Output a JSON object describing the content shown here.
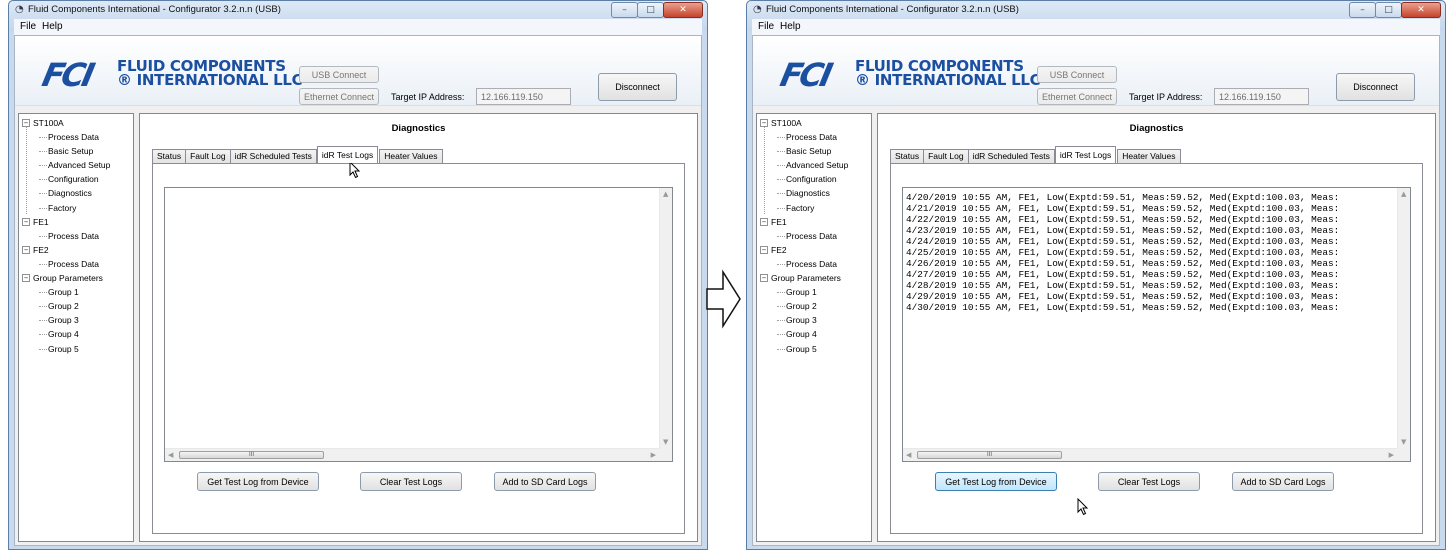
{
  "window": {
    "title": "Fluid Components International - Configurator 3.2.n.n (USB)",
    "app_icon": "gauge-icon",
    "minimize_glyph": "–",
    "maximize_glyph": "□",
    "close_glyph": "✕"
  },
  "menu": {
    "file": "File",
    "help": "Help"
  },
  "logo": {
    "mark": "FCI",
    "line1": "FLUID COMPONENTS",
    "line2": "® INTERNATIONAL LLC"
  },
  "connection": {
    "usb_connect": "USB Connect",
    "ethernet_connect": "Ethernet Connect",
    "target_ip_label": "Target IP Address:",
    "target_ip_value": "12.166.119.150",
    "disconnect": "Disconnect"
  },
  "tree": {
    "toggle_glyph": "−",
    "st100a": "ST100A",
    "process_data": "Process Data",
    "basic_setup": "Basic Setup",
    "advanced_setup": "Advanced Setup",
    "configuration": "Configuration",
    "diagnostics": "Diagnostics",
    "factory": "Factory",
    "fe1": "FE1",
    "fe1_process_data": "Process Data",
    "fe2": "FE2",
    "fe2_process_data": "Process Data",
    "group_parameters": "Group Parameters",
    "group1": "Group 1",
    "group2": "Group 2",
    "group3": "Group 3",
    "group4": "Group 4",
    "group5": "Group 5"
  },
  "panel": {
    "title": "Diagnostics",
    "tabs": [
      "Status",
      "Fault Log",
      "idR Scheduled Tests",
      "idR Test Logs",
      "Heater Values"
    ],
    "active_tab": "idR Test Logs"
  },
  "buttons": {
    "get_test_log": "Get Test Log from Device",
    "clear_test_logs": "Clear Test Logs",
    "add_to_sd": "Add to SD Card Logs"
  },
  "log_lines": [
    "4/20/2019 10:55 AM, FE1, Low(Exptd:59.51, Meas:59.52, Med(Exptd:100.03, Meas:",
    "4/21/2019 10:55 AM, FE1, Low(Exptd:59.51, Meas:59.52, Med(Exptd:100.03, Meas:",
    "4/22/2019 10:55 AM, FE1, Low(Exptd:59.51, Meas:59.52, Med(Exptd:100.03, Meas:",
    "4/23/2019 10:55 AM, FE1, Low(Exptd:59.51, Meas:59.52, Med(Exptd:100.03, Meas:",
    "4/24/2019 10:55 AM, FE1, Low(Exptd:59.51, Meas:59.52, Med(Exptd:100.03, Meas:",
    "4/25/2019 10:55 AM, FE1, Low(Exptd:59.51, Meas:59.52, Med(Exptd:100.03, Meas:",
    "4/26/2019 10:55 AM, FE1, Low(Exptd:59.51, Meas:59.52, Med(Exptd:100.03, Meas:",
    "4/27/2019 10:55 AM, FE1, Low(Exptd:59.51, Meas:59.52, Med(Exptd:100.03, Meas:",
    "4/28/2019 10:55 AM, FE1, Low(Exptd:59.51, Meas:59.52, Med(Exptd:100.03, Meas:",
    "4/29/2019 10:55 AM, FE1, Low(Exptd:59.51, Meas:59.52, Med(Exptd:100.03, Meas:",
    "4/30/2019 10:55 AM, FE1, Low(Exptd:59.51, Meas:59.52, Med(Exptd:100.03, Meas:"
  ],
  "scroll": {
    "up_glyph": "▲",
    "down_glyph": "▼",
    "left_glyph": "◀",
    "right_glyph": "▶",
    "thumb_grip": "III"
  },
  "colors": {
    "brand_blue": "#1b4fa0",
    "window_frame": "#c9daee",
    "close_red": "#c6432b"
  },
  "transition_icon": "right-arrow-icon"
}
